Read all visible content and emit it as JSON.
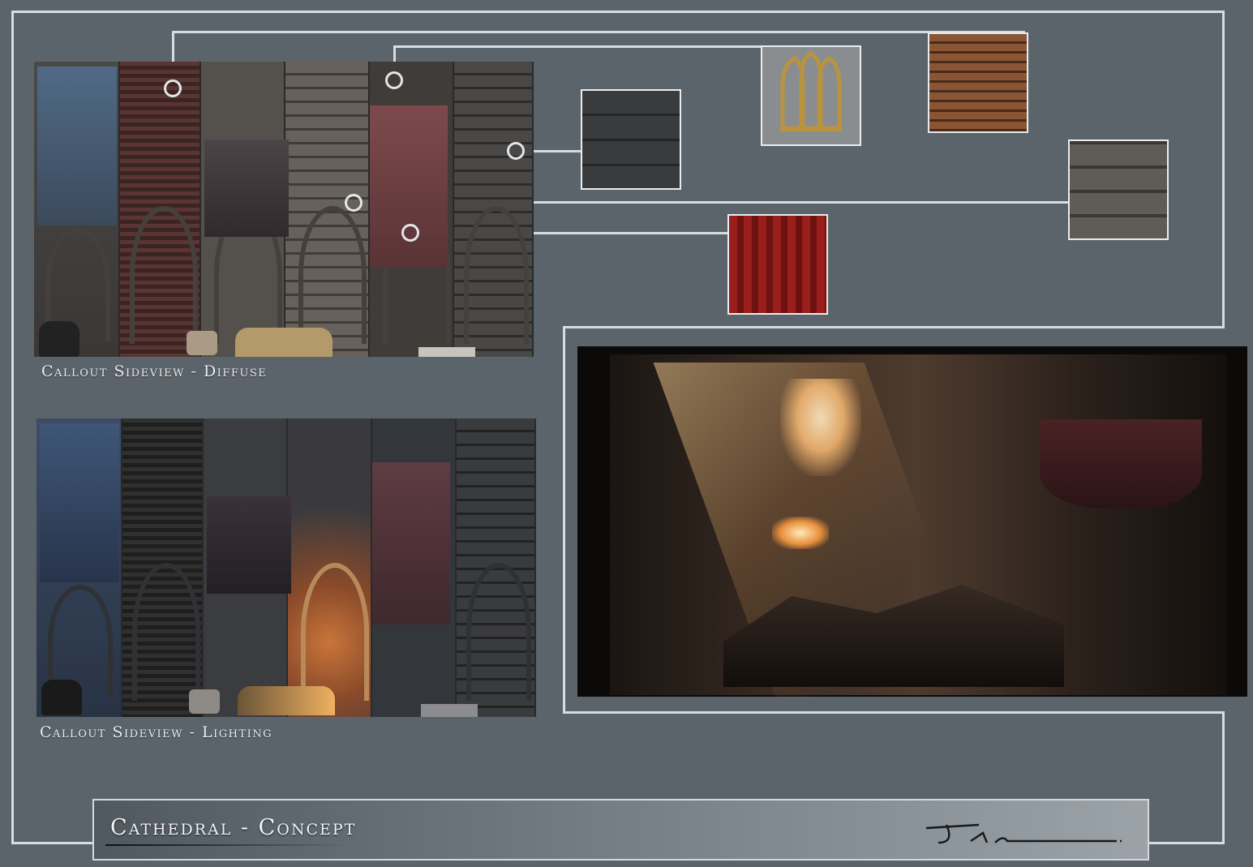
{
  "captions": {
    "diffuse": "Callout Sideview - Diffuse",
    "lighting": "Callout Sideview - Lighting"
  },
  "title": "Cathedral - Concept",
  "swatches": [
    {
      "name": "dark-wood-texture",
      "color": "#3c3d3e"
    },
    {
      "name": "gothic-window-frame",
      "color": "#8c8f92"
    },
    {
      "name": "wood-slats-texture",
      "color": "#7a4a2c"
    },
    {
      "name": "stone-wall-texture",
      "color": "#5d5a55"
    },
    {
      "name": "red-cloth-texture",
      "color": "#8a1a18"
    }
  ],
  "colors": {
    "background": "#5c646b",
    "frame": "#d8dcdf",
    "accent_red": "#8a1a18",
    "warm_light": "#f0b060"
  }
}
